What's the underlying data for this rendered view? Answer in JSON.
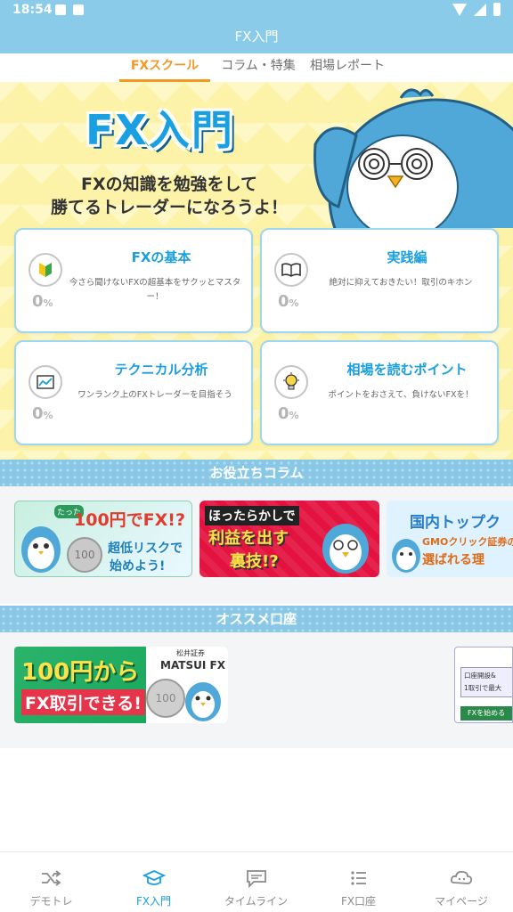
{
  "status_bar": {
    "time": "18:54"
  },
  "app_bar": {
    "title": "FX入門"
  },
  "tabs": [
    {
      "label": "FXスクール",
      "active": true
    },
    {
      "label": "コラム・特集",
      "active": false
    },
    {
      "label": "相場レポート",
      "active": false
    }
  ],
  "hero": {
    "title": "FX入門",
    "subtitle_line1": "FXの知識を勉強をして",
    "subtitle_line2": "勝てるトレーダーになろうよ！"
  },
  "courses": [
    {
      "icon": "beginner-mark-icon",
      "title": "FXの基本",
      "description": "今さら聞けないFXの超基本をサクッとマスター！",
      "progress": "0",
      "unit": "%"
    },
    {
      "icon": "book-icon",
      "title": "実践編",
      "description": "絶対に抑えておきたい！取引のキホン",
      "progress": "0",
      "unit": "%"
    },
    {
      "icon": "chart-icon",
      "title": "テクニカル分析",
      "description": "ワンランク上のFXトレーダーを目指そう",
      "progress": "0",
      "unit": "%"
    },
    {
      "icon": "lightbulb-icon",
      "title": "相場を読むポイント",
      "description": "ポイントをおさえて、負けないFXを！",
      "progress": "0",
      "unit": "%"
    }
  ],
  "columns_section": {
    "title": "お役立ちコラム",
    "banners": [
      {
        "tag": "たった",
        "line1": "100円でFX!?",
        "line2": "超低リスクで",
        "line3": "始めよう!",
        "coin": "100"
      },
      {
        "line1": "ほったらかしで",
        "line2": "利益を出す",
        "line3": "裏技!?"
      },
      {
        "line1": "国内トップク",
        "line2": "GMOクリック証券の",
        "line3": "選ばれる理"
      }
    ]
  },
  "accounts_section": {
    "title": "オススメ口座",
    "banners": [
      {
        "line1": "100円から",
        "line2": "FX取引できる!",
        "brand_small": "松井証券",
        "brand": "MATSUI FX",
        "coin": "100"
      },
      {
        "line1": "口座開設&",
        "line2": "1取引で最大",
        "line3": "FXを始める"
      }
    ]
  },
  "bottom_nav": [
    {
      "label": "デモトレ",
      "icon": "shuffle-icon",
      "active": false
    },
    {
      "label": "FX入門",
      "icon": "graduation-cap-icon",
      "active": true
    },
    {
      "label": "タイムライン",
      "icon": "chat-bubble-icon",
      "active": false
    },
    {
      "label": "FX口座",
      "icon": "list-icon",
      "active": false
    },
    {
      "label": "マイページ",
      "icon": "cloud-face-icon",
      "active": false
    }
  ],
  "colors": {
    "accent": "#1a9fe0",
    "header": "#89cbe8",
    "tab_active": "#f09a25",
    "hero_bg": "#fdf3a8"
  }
}
